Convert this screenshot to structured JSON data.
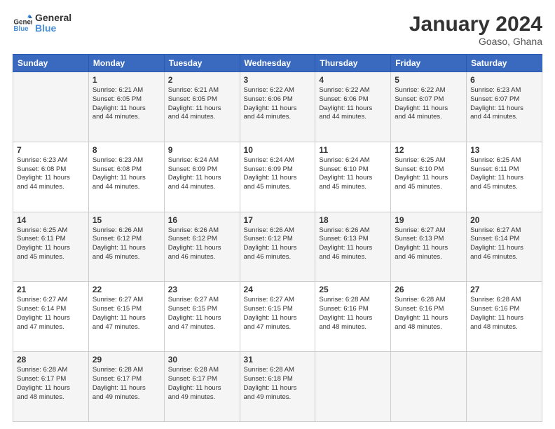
{
  "header": {
    "logo_line1": "General",
    "logo_line2": "Blue",
    "month_year": "January 2024",
    "location": "Goaso, Ghana"
  },
  "columns": [
    "Sunday",
    "Monday",
    "Tuesday",
    "Wednesday",
    "Thursday",
    "Friday",
    "Saturday"
  ],
  "rows": [
    [
      {
        "day": "",
        "info": ""
      },
      {
        "day": "1",
        "info": "Sunrise: 6:21 AM\nSunset: 6:05 PM\nDaylight: 11 hours\nand 44 minutes."
      },
      {
        "day": "2",
        "info": "Sunrise: 6:21 AM\nSunset: 6:05 PM\nDaylight: 11 hours\nand 44 minutes."
      },
      {
        "day": "3",
        "info": "Sunrise: 6:22 AM\nSunset: 6:06 PM\nDaylight: 11 hours\nand 44 minutes."
      },
      {
        "day": "4",
        "info": "Sunrise: 6:22 AM\nSunset: 6:06 PM\nDaylight: 11 hours\nand 44 minutes."
      },
      {
        "day": "5",
        "info": "Sunrise: 6:22 AM\nSunset: 6:07 PM\nDaylight: 11 hours\nand 44 minutes."
      },
      {
        "day": "6",
        "info": "Sunrise: 6:23 AM\nSunset: 6:07 PM\nDaylight: 11 hours\nand 44 minutes."
      }
    ],
    [
      {
        "day": "7",
        "info": "Sunrise: 6:23 AM\nSunset: 6:08 PM\nDaylight: 11 hours\nand 44 minutes."
      },
      {
        "day": "8",
        "info": "Sunrise: 6:23 AM\nSunset: 6:08 PM\nDaylight: 11 hours\nand 44 minutes."
      },
      {
        "day": "9",
        "info": "Sunrise: 6:24 AM\nSunset: 6:09 PM\nDaylight: 11 hours\nand 44 minutes."
      },
      {
        "day": "10",
        "info": "Sunrise: 6:24 AM\nSunset: 6:09 PM\nDaylight: 11 hours\nand 45 minutes."
      },
      {
        "day": "11",
        "info": "Sunrise: 6:24 AM\nSunset: 6:10 PM\nDaylight: 11 hours\nand 45 minutes."
      },
      {
        "day": "12",
        "info": "Sunrise: 6:25 AM\nSunset: 6:10 PM\nDaylight: 11 hours\nand 45 minutes."
      },
      {
        "day": "13",
        "info": "Sunrise: 6:25 AM\nSunset: 6:11 PM\nDaylight: 11 hours\nand 45 minutes."
      }
    ],
    [
      {
        "day": "14",
        "info": "Sunrise: 6:25 AM\nSunset: 6:11 PM\nDaylight: 11 hours\nand 45 minutes."
      },
      {
        "day": "15",
        "info": "Sunrise: 6:26 AM\nSunset: 6:12 PM\nDaylight: 11 hours\nand 45 minutes."
      },
      {
        "day": "16",
        "info": "Sunrise: 6:26 AM\nSunset: 6:12 PM\nDaylight: 11 hours\nand 46 minutes."
      },
      {
        "day": "17",
        "info": "Sunrise: 6:26 AM\nSunset: 6:12 PM\nDaylight: 11 hours\nand 46 minutes."
      },
      {
        "day": "18",
        "info": "Sunrise: 6:26 AM\nSunset: 6:13 PM\nDaylight: 11 hours\nand 46 minutes."
      },
      {
        "day": "19",
        "info": "Sunrise: 6:27 AM\nSunset: 6:13 PM\nDaylight: 11 hours\nand 46 minutes."
      },
      {
        "day": "20",
        "info": "Sunrise: 6:27 AM\nSunset: 6:14 PM\nDaylight: 11 hours\nand 46 minutes."
      }
    ],
    [
      {
        "day": "21",
        "info": "Sunrise: 6:27 AM\nSunset: 6:14 PM\nDaylight: 11 hours\nand 47 minutes."
      },
      {
        "day": "22",
        "info": "Sunrise: 6:27 AM\nSunset: 6:15 PM\nDaylight: 11 hours\nand 47 minutes."
      },
      {
        "day": "23",
        "info": "Sunrise: 6:27 AM\nSunset: 6:15 PM\nDaylight: 11 hours\nand 47 minutes."
      },
      {
        "day": "24",
        "info": "Sunrise: 6:27 AM\nSunset: 6:15 PM\nDaylight: 11 hours\nand 47 minutes."
      },
      {
        "day": "25",
        "info": "Sunrise: 6:28 AM\nSunset: 6:16 PM\nDaylight: 11 hours\nand 48 minutes."
      },
      {
        "day": "26",
        "info": "Sunrise: 6:28 AM\nSunset: 6:16 PM\nDaylight: 11 hours\nand 48 minutes."
      },
      {
        "day": "27",
        "info": "Sunrise: 6:28 AM\nSunset: 6:16 PM\nDaylight: 11 hours\nand 48 minutes."
      }
    ],
    [
      {
        "day": "28",
        "info": "Sunrise: 6:28 AM\nSunset: 6:17 PM\nDaylight: 11 hours\nand 48 minutes."
      },
      {
        "day": "29",
        "info": "Sunrise: 6:28 AM\nSunset: 6:17 PM\nDaylight: 11 hours\nand 49 minutes."
      },
      {
        "day": "30",
        "info": "Sunrise: 6:28 AM\nSunset: 6:17 PM\nDaylight: 11 hours\nand 49 minutes."
      },
      {
        "day": "31",
        "info": "Sunrise: 6:28 AM\nSunset: 6:18 PM\nDaylight: 11 hours\nand 49 minutes."
      },
      {
        "day": "",
        "info": ""
      },
      {
        "day": "",
        "info": ""
      },
      {
        "day": "",
        "info": ""
      }
    ]
  ]
}
